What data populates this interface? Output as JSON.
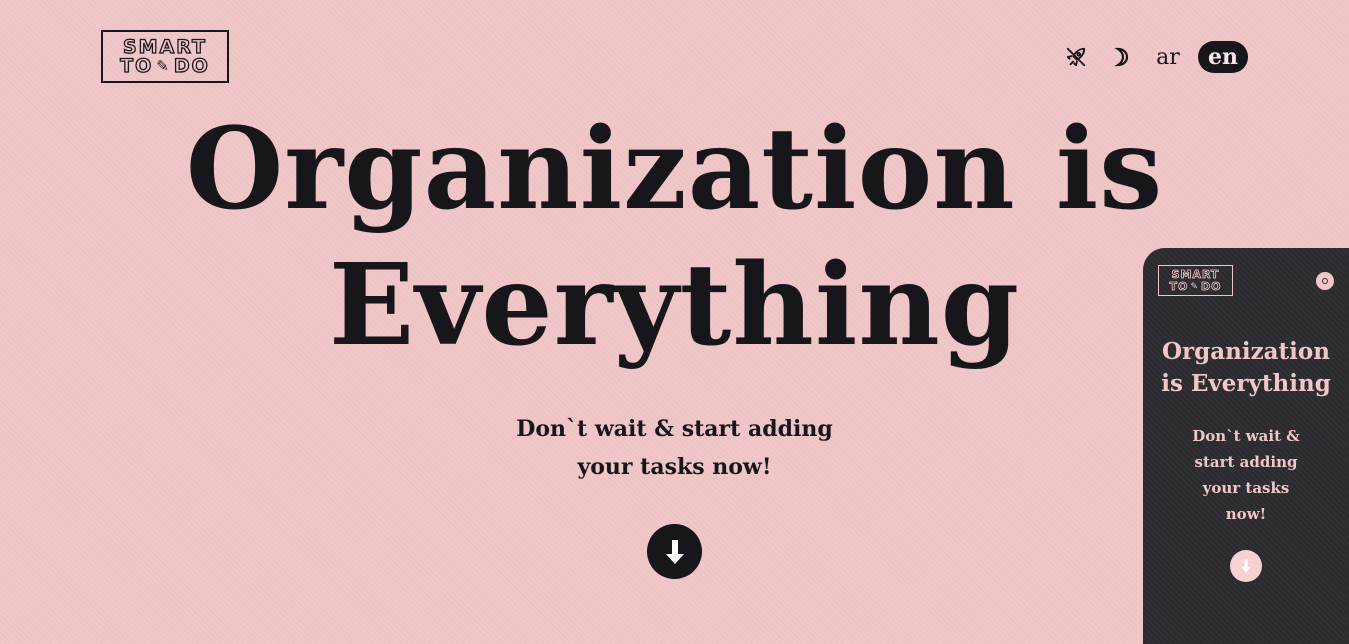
{
  "logo": {
    "line1": "SMART",
    "line2_left": "TO",
    "line2_right": "DO",
    "icon": "pencil-icon"
  },
  "nav": {
    "theme_icon_1": "rocket-off-icon",
    "theme_icon_2": "moon-icon",
    "lang_ar": "ar",
    "lang_en": "en",
    "active_lang": "en"
  },
  "hero": {
    "title": "Organization is Everything",
    "title_line1": "Organization is",
    "title_line2": "Everything",
    "subtitle_line1": "Don`t wait & start adding",
    "subtitle_line2": "your tasks now!",
    "down_icon": "arrow-down-icon"
  },
  "preview_panel": {
    "logo_line1": "SMART",
    "logo_line2_left": "TO",
    "logo_line2_right": "DO",
    "title_line1": "Organization",
    "title_line2": "is Everything",
    "sub_line1": "Don`t wait &",
    "sub_line2": "start adding",
    "sub_line3": "your tasks",
    "sub_line4": "now!",
    "close_icon": "close-icon",
    "down_icon": "arrow-down-icon"
  },
  "colors": {
    "background": "#f0c6c7",
    "ink": "#17161b",
    "panel": "#2c2b30"
  }
}
